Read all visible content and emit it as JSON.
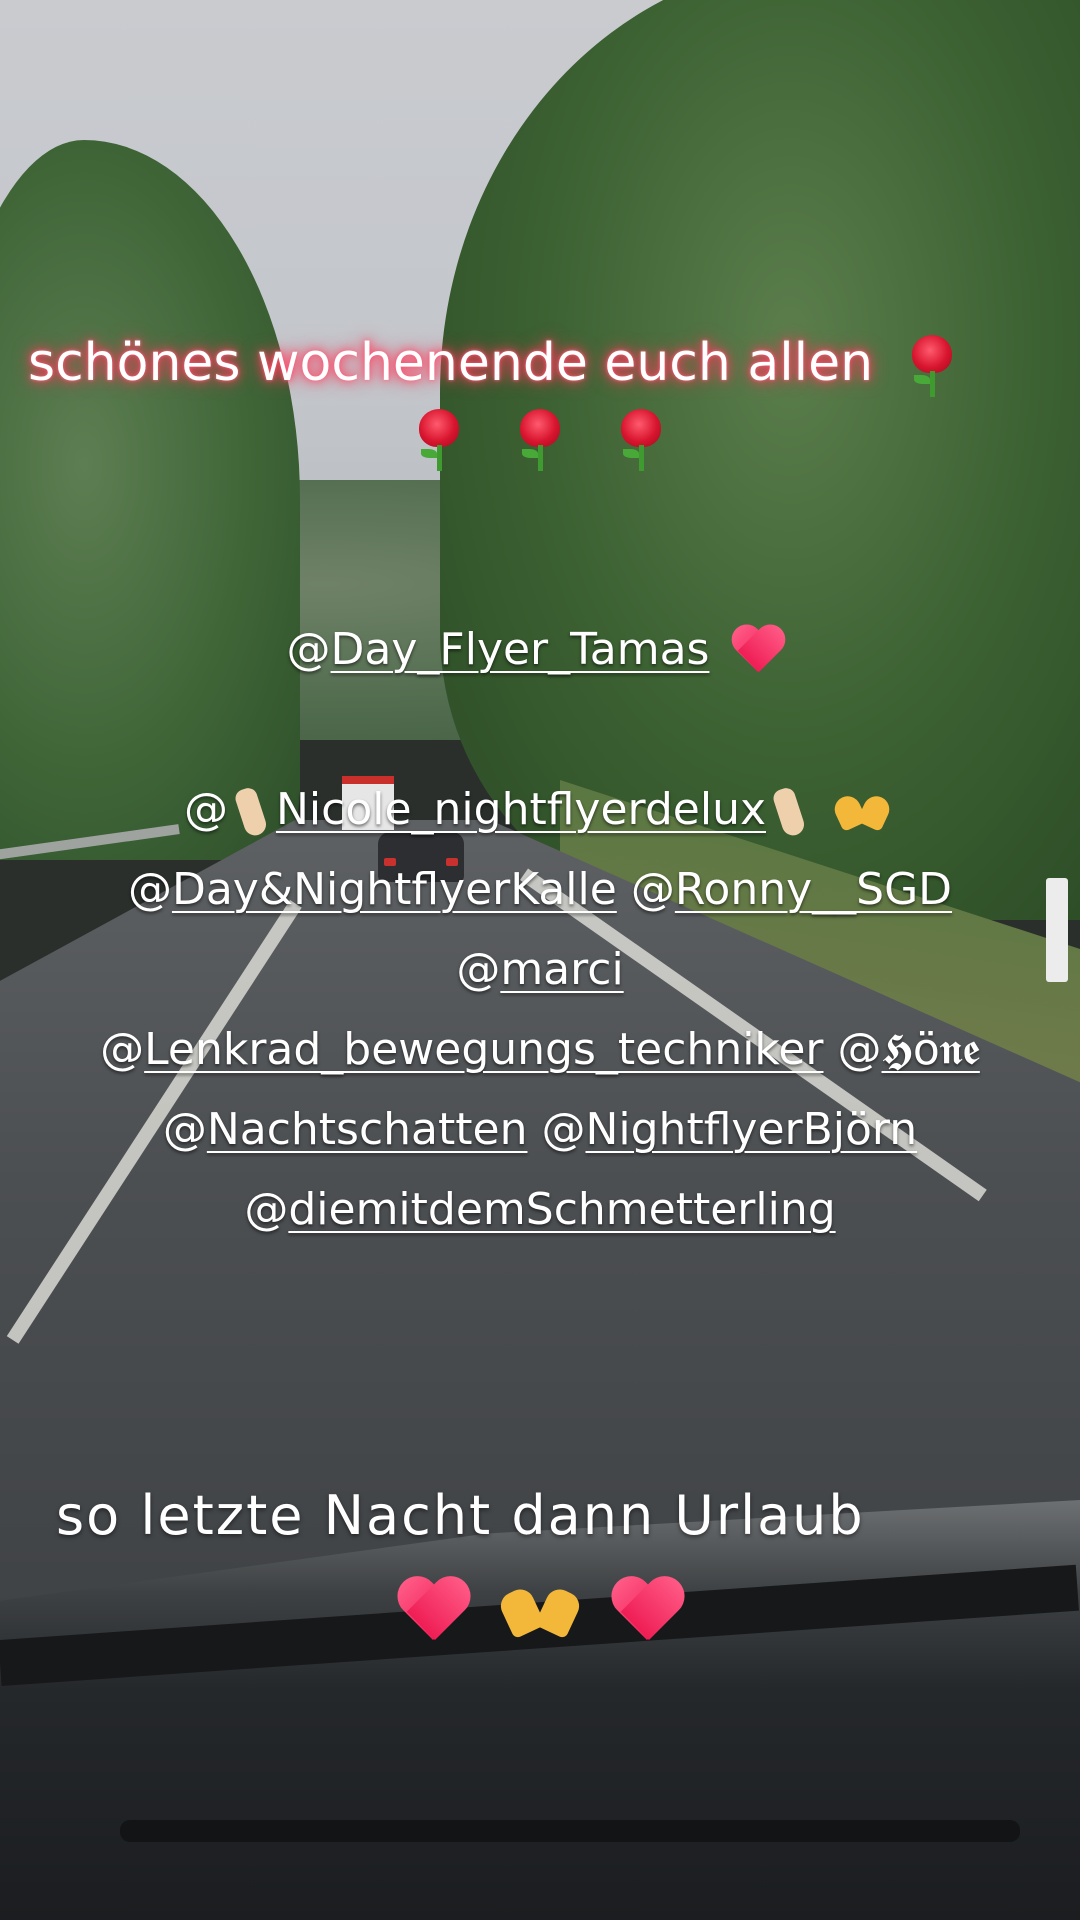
{
  "headline": {
    "text": "schönes wochenende euch allen",
    "roses_after_text": 1,
    "roses_second_line": 3,
    "glow_color": "#ff3a5c"
  },
  "mentions": {
    "first": "Day_Flyer_Tamas",
    "nicole": "Nicole_nightflyerdelux",
    "kalle": "Day&NightflyerKalle",
    "ronny": "Ronny__SGD",
    "marci": "marci",
    "lenkrad": "Lenkrad_bewegungs_techniker",
    "hoene": "𝕳ö𝖓𝖊",
    "nachtschatten": "Nachtschatten",
    "bjoern": "NightflyerBjörn",
    "schmetterling": "diemitdemSchmetterling",
    "at_sign": "@"
  },
  "footer": {
    "text": "so letzte Nacht dann Urlaub"
  },
  "icons": {
    "rose": "rose-emoji",
    "heart": "red-heart-emoji",
    "heart_hands": "heart-hands-emoji",
    "crossed_fingers": "crossed-fingers-emoji"
  }
}
